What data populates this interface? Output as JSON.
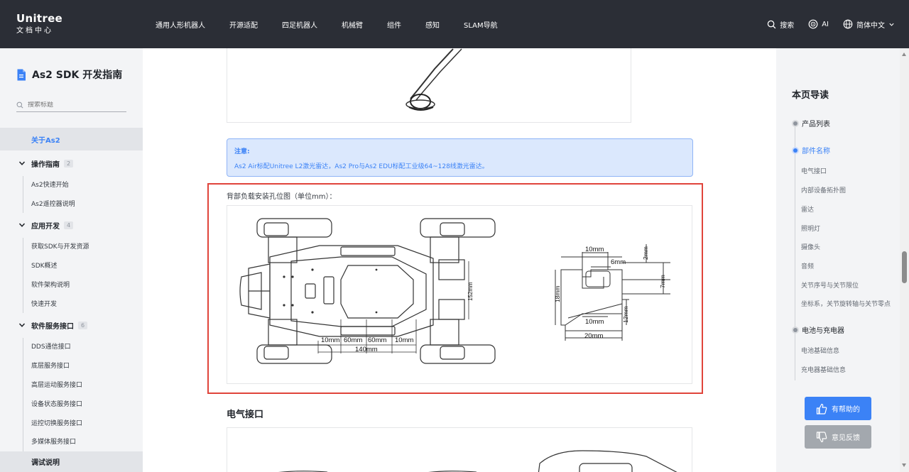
{
  "brand": {
    "name": "Unitree",
    "subtitle": "文档中心"
  },
  "topnav": {
    "items": [
      "通用人形机器人",
      "开源适配",
      "四足机器人",
      "机械臂",
      "组件",
      "感知",
      "SLAM导航"
    ],
    "search_label": "搜索",
    "ai_label": "AI",
    "language_label": "简体中文"
  },
  "sidebar": {
    "title": "As2 SDK 开发指南",
    "search_placeholder": "搜索标题",
    "active_item": "关于As2",
    "sections": [
      {
        "label": "操作指南",
        "count": "2",
        "items": [
          "As2快速开始",
          "As2遥控器说明"
        ]
      },
      {
        "label": "应用开发",
        "count": "4",
        "items": [
          "获取SDK与开发资源",
          "SDK概述",
          "软件架构说明",
          "快速开发"
        ]
      },
      {
        "label": "软件服务接口",
        "count": "6",
        "items": [
          "DDS通信接口",
          "底层服务接口",
          "高层运动服务接口",
          "设备状态服务接口",
          "运控切换服务接口",
          "多媒体服务接口"
        ]
      }
    ],
    "bottom_item": "调试说明"
  },
  "main": {
    "note_title": "注意:",
    "note_text": "As2 Air标配Unitree L2激光雷达，As2 Pro与As2 EDU标配工业级64~128线激光雷达。",
    "caption": "背部负载安装孔位图（单位mm）：",
    "diagram_labels": {
      "d10a": "10mm",
      "d60a": "60mm",
      "d60b": "60mm",
      "d10b": "10mm",
      "d140": "140mm",
      "d152": "152mm",
      "p10top": "10mm",
      "p6": "6mm",
      "p2": "2mm",
      "p7": "7mm",
      "p18": "18mm",
      "p10bot": "10mm",
      "p12": "12mm",
      "p20": "20mm"
    },
    "section_heading": "电气接口"
  },
  "toc": {
    "title": "本页导读",
    "items": [
      {
        "label": "产品列表",
        "active": false,
        "subs": []
      },
      {
        "label": "部件名称",
        "active": true,
        "subs": [
          "电气接口",
          "内部设备拓扑图",
          "雷达",
          "照明灯",
          "摄像头",
          "音频",
          "关节序号与关节限位",
          "坐标系，关节旋转轴与关节零点"
        ]
      },
      {
        "label": "电池与充电器",
        "active": false,
        "subs": [
          "电池基础信息",
          "充电器基础信息"
        ]
      }
    ],
    "helpful_label": "有帮助的",
    "feedback_label": "意见反馈"
  },
  "colors": {
    "accent": "#3b82f6",
    "nav_bg": "#2b2e36",
    "highlight": "#e0443b"
  }
}
